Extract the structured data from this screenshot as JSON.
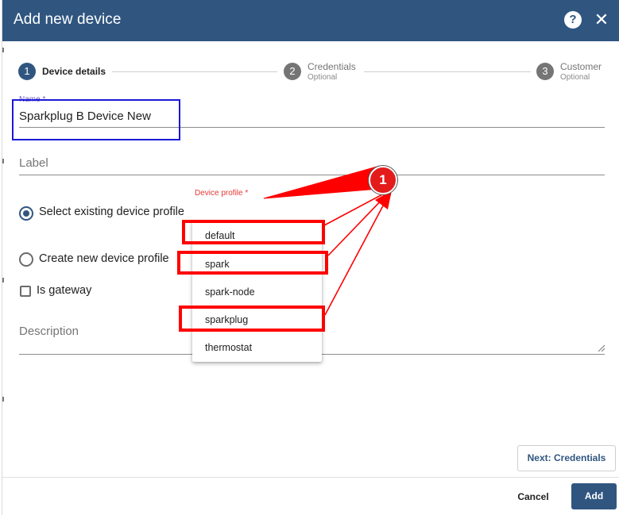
{
  "dialog": {
    "title": "Add new device",
    "help_icon": "question-circle-icon",
    "close_icon": "close-icon"
  },
  "stepper": {
    "steps": [
      {
        "number": "1",
        "label": "Device details",
        "sublabel": "",
        "state": "active"
      },
      {
        "number": "2",
        "label": "Credentials",
        "sublabel": "Optional",
        "state": "inactive"
      },
      {
        "number": "3",
        "label": "Customer",
        "sublabel": "Optional",
        "state": "inactive"
      }
    ]
  },
  "form": {
    "name": {
      "label": "Name *",
      "value": "Sparkplug B Device New"
    },
    "label_field": {
      "placeholder": "Label"
    },
    "device_profile": {
      "label": "Device profile *",
      "options": [
        "default",
        "spark",
        "spark-node",
        "sparkplug",
        "thermostat"
      ]
    },
    "profile_mode": {
      "options": [
        {
          "label": "Select existing device profile",
          "checked": true
        },
        {
          "label": "Create new device profile",
          "checked": false
        }
      ]
    },
    "is_gateway": {
      "label": "Is gateway",
      "checked": false
    },
    "description": {
      "placeholder": "Description"
    }
  },
  "footer": {
    "next_label": "Next: Credentials",
    "cancel_label": "Cancel",
    "add_label": "Add"
  },
  "annotation": {
    "badge_number": "1",
    "color": "#ff0000"
  },
  "colors": {
    "header": "#305680",
    "accent": "#305680",
    "required_label": "#e53935",
    "highlight_blue": "#1a1ad6"
  }
}
